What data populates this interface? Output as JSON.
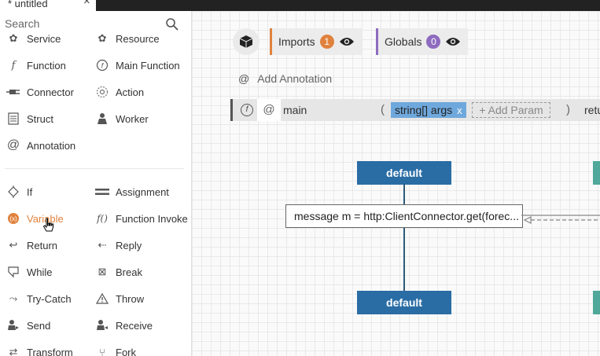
{
  "tab": {
    "title": "* untitled",
    "close": "×"
  },
  "search": {
    "placeholder": "Search"
  },
  "tools": {
    "service": "Service",
    "resource": "Resource",
    "function": "Function",
    "main_function": "Main Function",
    "connector": "Connector",
    "action": "Action",
    "struct": "Struct",
    "worker": "Worker",
    "annotation": "Annotation",
    "if": "If",
    "assignment": "Assignment",
    "variable": "Variable",
    "function_invoke": "Function Invoke",
    "return": "Return",
    "reply": "Reply",
    "while": "While",
    "break": "Break",
    "try_catch": "Try-Catch",
    "throw": "Throw",
    "send": "Send",
    "receive": "Receive",
    "transform": "Transform",
    "fork": "Fork"
  },
  "header": {
    "imports_label": "Imports",
    "imports_count": "1",
    "globals_label": "Globals",
    "globals_count": "0",
    "add_annotation": "Add Annotation"
  },
  "function": {
    "at": "@",
    "name": "main",
    "open_paren": "(",
    "close_paren": ")",
    "param": "string[] args",
    "param_remove": "x",
    "add_param": "+ Add Param",
    "return_text": "retu"
  },
  "diagram": {
    "worker_top": "default",
    "worker_bottom": "default",
    "statement": "message m = http:ClientConnector.get(forec..."
  },
  "colors": {
    "imports_accent": "#e0823d",
    "globals_accent": "#8e6bbf",
    "worker": "#2a6da5",
    "active_tool": "#e0823d",
    "teal": "#4fa89a"
  }
}
